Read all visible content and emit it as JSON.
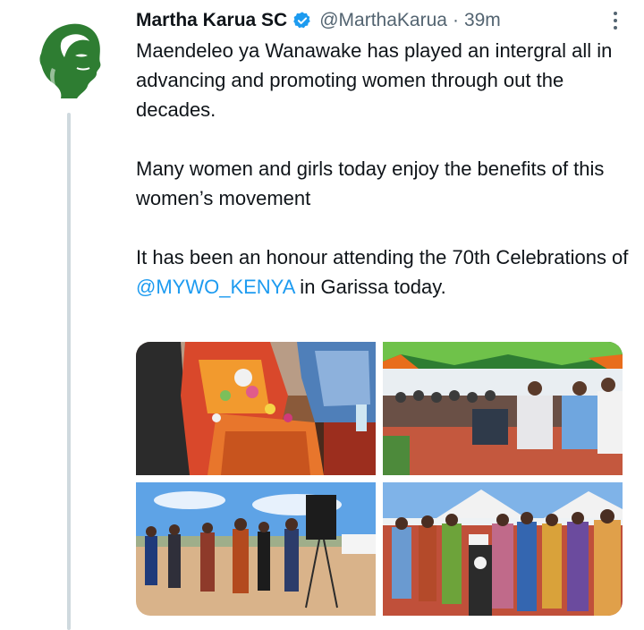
{
  "author": {
    "name": "Martha Karua SC",
    "handle": "@MarthaKarua",
    "separator": "·",
    "time": "39m",
    "verified": true,
    "avatar_icon": "profile-silhouette-logo",
    "brand_color": "#2e7d32"
  },
  "tweet": {
    "line1": "Maendeleo ya Wanawake has played an intergral all in advancing and promoting women through out the decades.",
    "line2": "Many women and girls today enjoy the benefits of this women’s movement",
    "line3_before": "It has been an honour attending the 70th Celebrations of ",
    "mention": "@MYWO_KENYA",
    "line3_after": " in Garissa today."
  },
  "colors": {
    "text": "#0f1419",
    "secondary": "#536471",
    "link": "#1d9bf0",
    "thread_line": "#cfd9de"
  },
  "media": {
    "count": 4,
    "photos": [
      {
        "icon": "photo-women-seated-garlands"
      },
      {
        "icon": "photo-tent-audience"
      },
      {
        "icon": "photo-outdoor-procession"
      },
      {
        "icon": "photo-podium-group"
      }
    ]
  }
}
